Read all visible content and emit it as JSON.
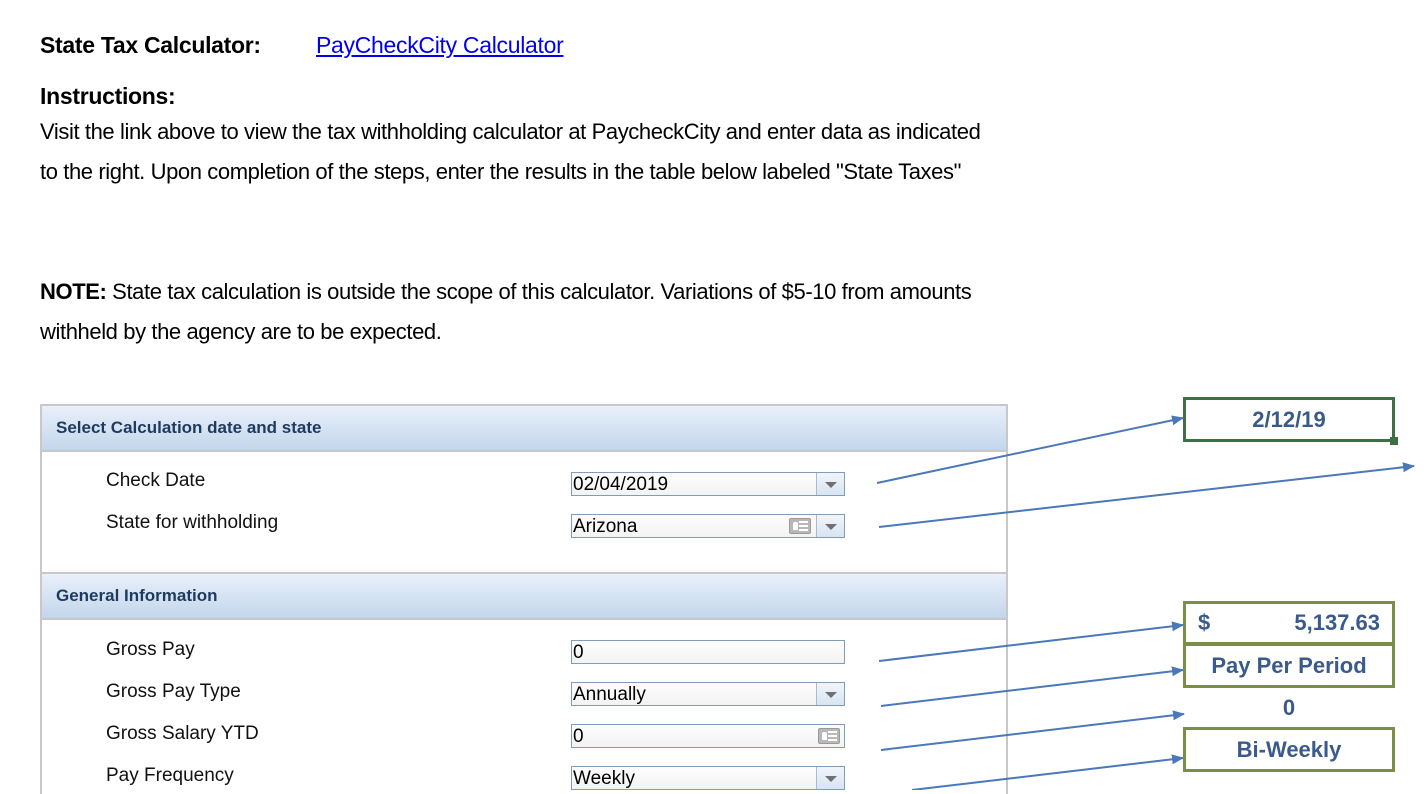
{
  "header": {
    "title_label": "State Tax Calculator:",
    "link_text": "PayCheckCity Calculator"
  },
  "instructions": {
    "heading": "Instructions:",
    "body": "Visit the link above to view the tax withholding calculator at PaycheckCity and enter data as indicated to the right. Upon completion of the steps, enter the results in the table below labeled \"State Taxes\"",
    "note_label": "NOTE:",
    "note_text": " State tax calculation is outside the scope of this calculator. Variations of $5-10 from amounts withheld by the agency are to be expected."
  },
  "calculator": {
    "section1": {
      "title": "Select Calculation date and state",
      "fields": [
        {
          "label": "Check Date",
          "value": "02/04/2019",
          "type": "dropdown"
        },
        {
          "label": "State for withholding",
          "value": "Arizona",
          "type": "dropdown-card"
        }
      ]
    },
    "section2": {
      "title": "General Information",
      "fields": [
        {
          "label": "Gross Pay",
          "value": "0",
          "type": "text"
        },
        {
          "label": "Gross Pay Type",
          "value": "Annually",
          "type": "dropdown"
        },
        {
          "label": "Gross Salary YTD",
          "value": "0",
          "type": "text-card"
        },
        {
          "label": "Pay Frequency",
          "value": "Weekly",
          "type": "dropdown"
        }
      ]
    }
  },
  "results": {
    "check_date": "2/12/19",
    "gross_pay_currency": "$",
    "gross_pay_amount": "5,137.63",
    "gross_pay_type": "Pay Per Period",
    "gross_salary_ytd": "0",
    "pay_frequency": "Bi-Weekly"
  },
  "colors": {
    "arrow": "#4a78b8",
    "date_border": "#3f7045",
    "result_border": "#7a8f45",
    "result_text": "#3a5a8c",
    "link": "#0000ee"
  }
}
